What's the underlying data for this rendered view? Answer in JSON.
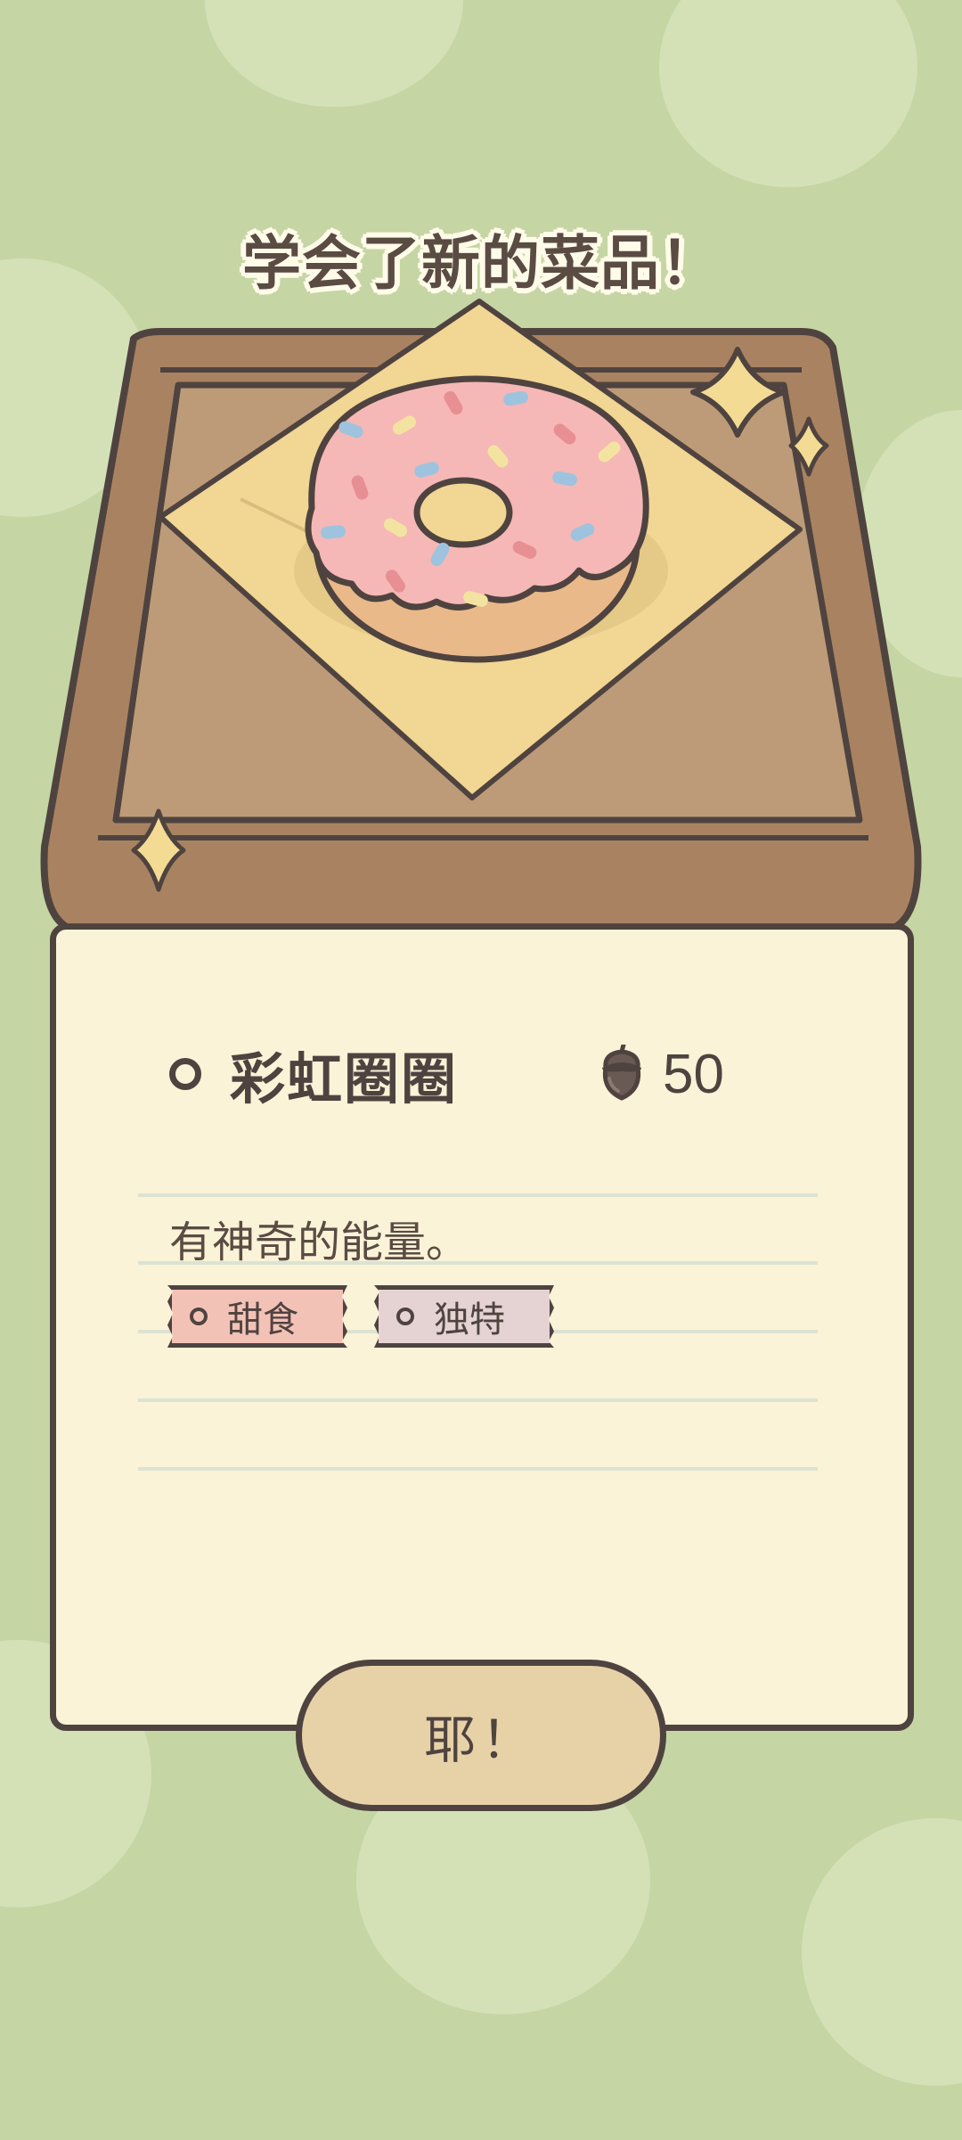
{
  "popup": {
    "headline": "学会了新的菜品！",
    "dish_name": "彩虹圈圈",
    "price": "50",
    "price_icon": "acorn-icon",
    "description": "有神奇的能量。",
    "tags": [
      "甜食",
      "独特"
    ],
    "confirm_label": "耶！"
  },
  "colors": {
    "background": "#c5d5a4",
    "card": "#fbf3d7",
    "outline": "#4f4340",
    "button": "#e7d2a8",
    "tag_sweet": "#f3c2b6",
    "tag_unique": "#e4d3d2"
  }
}
